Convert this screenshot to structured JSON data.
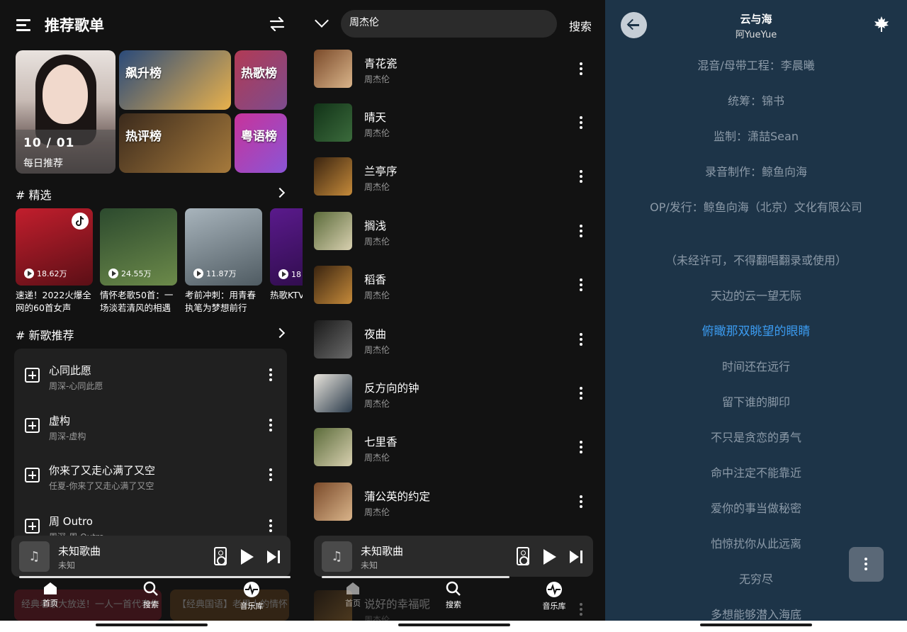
{
  "home": {
    "title": "推荐歌单",
    "daily": {
      "date": "10 / 01",
      "label": "每日推荐"
    },
    "ranks": [
      {
        "label": "飙升榜",
        "colors": [
          "#2a4a7a",
          "#e8b14c"
        ]
      },
      {
        "label": "热歌榜",
        "colors": [
          "#b23a55",
          "#7c4c8e"
        ]
      },
      {
        "label": "热评榜",
        "colors": [
          "#3b2a1c",
          "#a67a3c"
        ]
      },
      {
        "label": "粤语榜",
        "colors": [
          "#c8339a",
          "#8a55d6"
        ]
      }
    ],
    "featured_title": "# 精选",
    "playlists": [
      {
        "plays": "18.62万",
        "text": "速递！2022火爆全网的60首女声",
        "colors": [
          "#c21e2d",
          "#5b0f16"
        ]
      },
      {
        "plays": "24.55万",
        "text": "情怀老歌50首：一场淡若清风的相遇",
        "colors": [
          "#2c4a2e",
          "#6c8a4a"
        ]
      },
      {
        "plays": "11.87万",
        "text": "考前冲刺：用青春执笔为梦想前行",
        "colors": [
          "#a8b4bc",
          "#4f5b62"
        ]
      },
      {
        "plays": "18",
        "text": "热歌KTV霸，可能",
        "colors": [
          "#5a1a8c",
          "#2a0b44"
        ]
      }
    ],
    "new_title": "# 新歌推荐",
    "new_songs": [
      {
        "title": "心同此愿",
        "sub": "周深-心同此愿"
      },
      {
        "title": "虚构",
        "sub": "周深-虚构"
      },
      {
        "title": "你来了又走心满了又空",
        "sub": "任夏-你来了又走心满了又空"
      },
      {
        "title": "周 Outro",
        "sub": "周深-周 Outro"
      }
    ],
    "ghost_cards": [
      "经典老歌大放送！一人一首代表作",
      "【经典国语】老男人的情怀"
    ],
    "player": {
      "title": "未知歌曲",
      "sub": "未知",
      "progress": 1.0
    },
    "nav": [
      "首页",
      "搜索",
      "音乐库"
    ]
  },
  "search": {
    "query": "周杰伦",
    "button": "搜索",
    "results": [
      {
        "title": "青花瓷",
        "artist": "周杰伦",
        "colors": [
          "#7a4a2a",
          "#d9b48a"
        ]
      },
      {
        "title": "晴天",
        "artist": "周杰伦",
        "colors": [
          "#123318",
          "#3b6b3c"
        ]
      },
      {
        "title": "兰亭序",
        "artist": "周杰伦",
        "colors": [
          "#3a2410",
          "#c58a3a"
        ]
      },
      {
        "title": "搁浅",
        "artist": "周杰伦",
        "colors": [
          "#5b6b3a",
          "#d8d0b0"
        ]
      },
      {
        "title": "稻香",
        "artist": "周杰伦",
        "colors": [
          "#3a2410",
          "#c58a3a"
        ]
      },
      {
        "title": "夜曲",
        "artist": "周杰伦",
        "colors": [
          "#1a1a1a",
          "#6a6a6a"
        ]
      },
      {
        "title": "反方向的钟",
        "artist": "周杰伦",
        "colors": [
          "#e8e4dc",
          "#2a3a4a"
        ]
      },
      {
        "title": "七里香",
        "artist": "周杰伦",
        "colors": [
          "#5b6b3a",
          "#d8d0b0"
        ]
      },
      {
        "title": "蒲公英的约定",
        "artist": "周杰伦",
        "colors": [
          "#7a4a2a",
          "#d9b48a"
        ]
      },
      {
        "title": "说好的幸福呢",
        "artist": "周杰伦",
        "colors": [
          "#3a2410",
          "#c58a3a"
        ]
      }
    ],
    "player": {
      "title": "未知歌曲",
      "sub": "未知",
      "progress": 1.0
    },
    "nav": [
      "首页",
      "搜索",
      "音乐库"
    ]
  },
  "lyrics": {
    "song_title": "云与海",
    "artist": "阿YueYue",
    "lines": [
      "混音/母带工程：李晨曦",
      "统筹：锦书",
      "监制：潇喆Sean",
      "录音制作：鲸鱼向海",
      "OP/发行：鲸鱼向海（北京）文化有限公司",
      "（未经许可，不得翻唱翻录或使用）",
      "天边的云一望无际",
      "俯瞰那双眺望的眼睛",
      "时间还在远行",
      "留下谁的脚印",
      "不只是贪恋的勇气",
      "命中注定不能靠近",
      "爱你的事当做秘密",
      "怕惊扰你从此远离",
      "无穷尽",
      "多想能够潜入海底"
    ],
    "active_index": 7,
    "accent": "#3b9bf0"
  }
}
